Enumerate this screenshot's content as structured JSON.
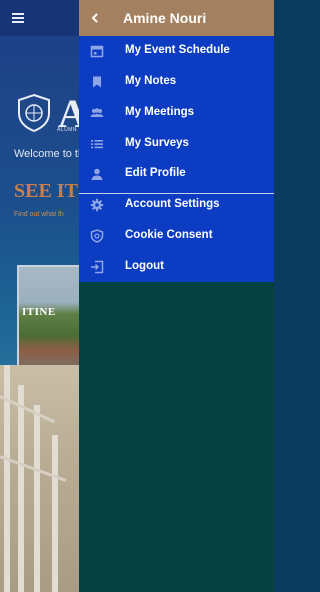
{
  "background": {
    "welcome_text": "Welcome to th",
    "logo_letter": "A",
    "alumni_text": "ALUMN",
    "headline": "SEE IT",
    "subline": "Find out what th",
    "card_title": "ITINE"
  },
  "drawer": {
    "user_name": "Amine Nouri",
    "items": [
      {
        "label": "My Event Schedule",
        "icon": "calendar-icon"
      },
      {
        "label": "My Notes",
        "icon": "bookmark-icon"
      },
      {
        "label": "My Meetings",
        "icon": "people-icon"
      },
      {
        "label": "My Surveys",
        "icon": "list-icon"
      },
      {
        "label": "Edit Profile",
        "icon": "person-icon"
      },
      {
        "label": "Account Settings",
        "icon": "gear-icon"
      },
      {
        "label": "Cookie Consent",
        "icon": "shield-icon"
      },
      {
        "label": "Logout",
        "icon": "logout-icon"
      }
    ]
  },
  "colors": {
    "header": "#a3805f",
    "menu_panel": "#0b3cc2",
    "drawer_body": "#05413f",
    "accent_orange": "#c87f4c"
  }
}
